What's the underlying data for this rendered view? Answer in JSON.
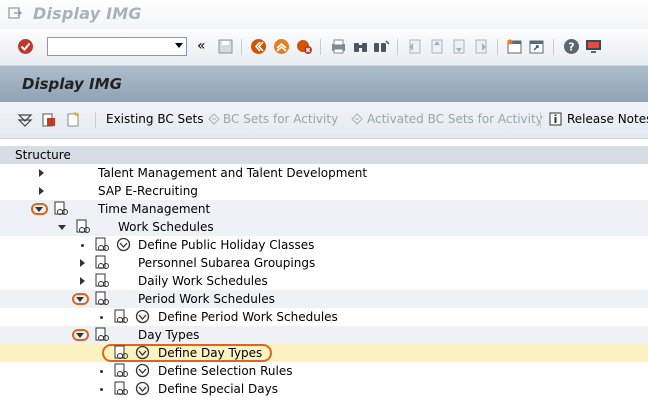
{
  "window": {
    "title": "Display IMG"
  },
  "toolbar": {
    "command_value": "",
    "more_glyph": "«"
  },
  "header": {
    "title": "Display IMG"
  },
  "app_toolbar": {
    "existing_bc_sets": "Existing BC Sets",
    "bc_sets_activity": "BC Sets for Activity",
    "activated_bc_sets": "Activated BC Sets for Activity",
    "release_notes": "Release Notes"
  },
  "structure": {
    "heading": "Structure",
    "items": [
      {
        "label": "Talent Management and Talent Development",
        "state": "collapsed"
      },
      {
        "label": "SAP E-Recruiting",
        "state": "collapsed"
      },
      {
        "label": "Time Management",
        "state": "expanded"
      },
      {
        "label": "Work Schedules",
        "state": "expanded"
      },
      {
        "label": "Define Public Holiday Classes",
        "state": "leaf"
      },
      {
        "label": "Personnel Subarea Groupings",
        "state": "collapsed"
      },
      {
        "label": "Daily Work Schedules",
        "state": "collapsed"
      },
      {
        "label": "Period Work Schedules",
        "state": "expanded"
      },
      {
        "label": "Define Period Work Schedules",
        "state": "leaf"
      },
      {
        "label": "Day Types",
        "state": "expanded"
      },
      {
        "label": "Define Day Types",
        "state": "leaf-selected"
      },
      {
        "label": "Define Selection Rules",
        "state": "leaf"
      },
      {
        "label": "Define Special Days",
        "state": "leaf"
      }
    ]
  },
  "colors": {
    "highlight_ring": "#e0641e",
    "selected_row": "#fdf3c2",
    "header_bar": "#9fb1c2"
  }
}
